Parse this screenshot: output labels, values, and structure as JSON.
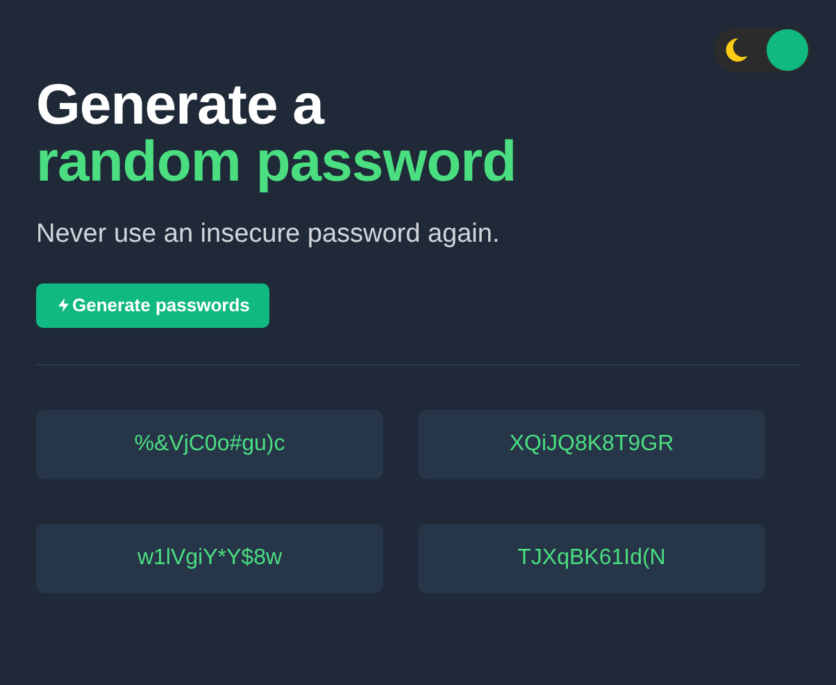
{
  "theme_toggle": {
    "on": true
  },
  "heading": {
    "line_1": "Generate a",
    "line_2": "random password"
  },
  "subtitle": "Never use an insecure password again.",
  "generate_button": {
    "label": "Generate passwords"
  },
  "passwords": [
    "%&VjC0o#gu)c",
    "XQiJQ8K8T9GR",
    "w1lVgiY*Y$8w",
    "TJXqBK61Id(N"
  ]
}
